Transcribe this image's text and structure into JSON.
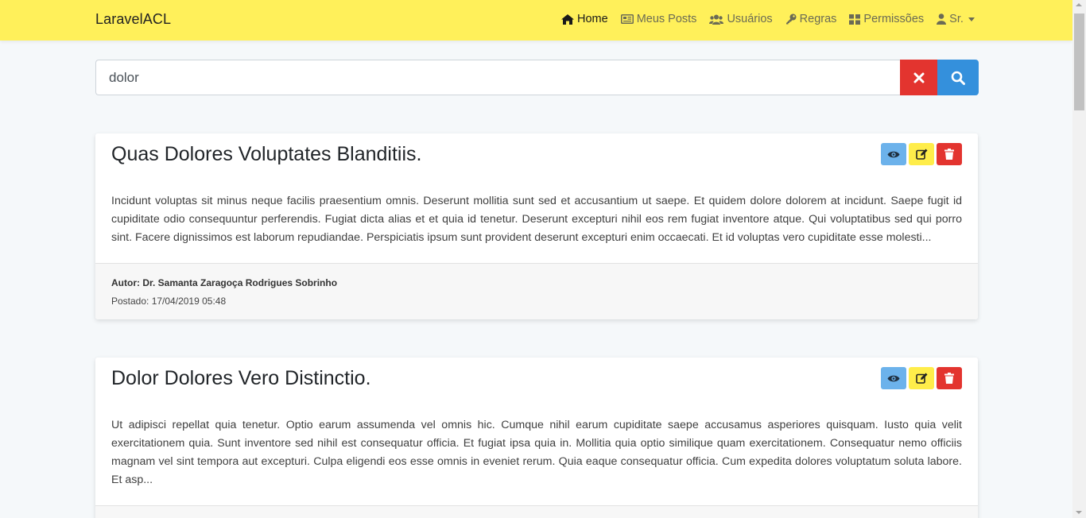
{
  "navbar": {
    "brand": "LaravelACL",
    "items": [
      {
        "label": "Home",
        "icon": "home-icon",
        "active": true
      },
      {
        "label": "Meus Posts",
        "icon": "newspaper-icon"
      },
      {
        "label": "Usuários",
        "icon": "users-icon"
      },
      {
        "label": "Regras",
        "icon": "key-icon"
      },
      {
        "label": "Permissões",
        "icon": "grid-icon"
      },
      {
        "label": "Sr.",
        "icon": "user-icon",
        "dropdown": true
      }
    ],
    "background": "#fff05a"
  },
  "search": {
    "value": "dolor",
    "clear_color": "#e3342f",
    "search_color": "#3490dc"
  },
  "posts": [
    {
      "title": "Quas Dolores Voluptates Blanditiis.",
      "body": "Incidunt voluptas sit minus neque facilis praesentium omnis. Deserunt mollitia sunt sed et accusantium ut saepe. Et quidem dolore dolorem at incidunt. Saepe fugit id cupiditate odio consequuntur perferendis. Fugiat dicta alias et et quia id tenetur. Deserunt excepturi nihil eos rem fugiat inventore atque. Qui voluptatibus sed qui porro sint. Facere dignissimos est laborum repudiandae. Perspiciatis ipsum sunt provident deserunt excepturi enim occaecati. Et id voluptas vero cupiditate esse molesti...",
      "author": "Autor: Dr. Samanta Zaragoça Rodrigues Sobrinho",
      "posted": "Postado: 17/04/2019 05:48"
    },
    {
      "title": "Dolor Dolores Vero Distinctio.",
      "body": "Ut adipisci repellat quia tenetur. Optio earum assumenda vel omnis hic. Cumque nihil earum cupiditate saepe accusamus asperiores quisquam. Iusto quia velit exercitationem quia. Sunt inventore sed nihil est consequatur officia. Et fugiat ipsa quia in. Mollitia quia optio similique quam exercitationem. Consequatur nemo officiis magnam vel sint tempora aut excepturi. Culpa eligendi eos esse omnis in eveniet rerum. Quia eaque consequatur officia. Cum expedita dolores voluptatum soluta labore. Et asp..."
    }
  ]
}
